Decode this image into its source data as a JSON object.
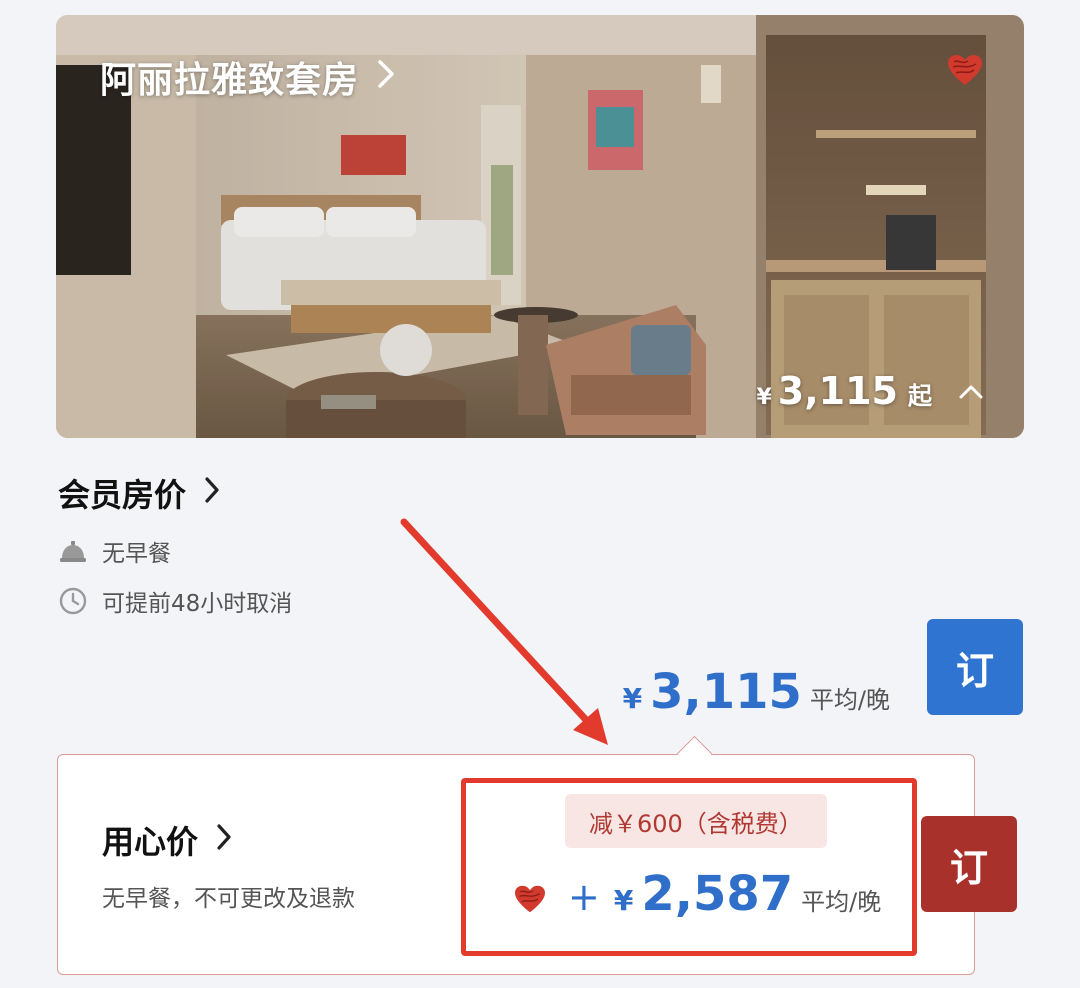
{
  "room": {
    "name": "阿丽拉雅致套房",
    "price_currency": "¥",
    "price_amount": "3,115",
    "price_suffix": "起"
  },
  "member_rate": {
    "title": "会员房价",
    "features": [
      {
        "icon": "service-bell-icon",
        "text": "无早餐"
      },
      {
        "icon": "clock-icon",
        "text": "可提前48小时取消"
      }
    ],
    "price_currency": "¥",
    "price_amount": "3,115",
    "price_suffix": "平均/晚",
    "book_label": "订"
  },
  "special_rate": {
    "title": "用心价",
    "subtitle": "无早餐，不可更改及退款",
    "discount_badge": "减￥600（含税费）",
    "plus_sign": "+",
    "price_currency": "¥",
    "price_amount": "2,587",
    "price_suffix": "平均/晚",
    "book_label": "订"
  },
  "colors": {
    "accent_blue": "#2f6fc9",
    "book_blue": "#2f74d0",
    "book_red": "#a8312b",
    "annotation_red": "#e23b2d",
    "badge_bg": "#f8e6e4"
  }
}
